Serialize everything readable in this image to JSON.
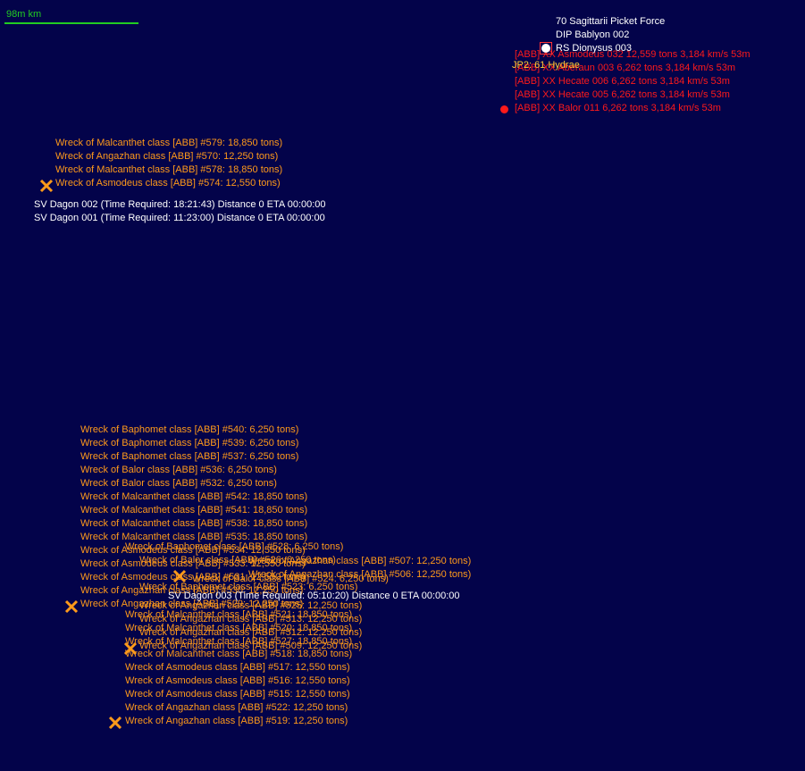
{
  "scale": {
    "label": "98m km"
  },
  "top_right": {
    "white_labels": [
      "70 Sagittarii Picket Force",
      "DIP Bablyon 002",
      "RS Dionysus 003"
    ],
    "jump_point": "JP2: 61 Hydrae",
    "red_labels": [
      "[ABB]  XX Asmodeus 032  12,559 tons   3,184 km/s  53m",
      "[ABB]  XX Aberaun 003  6,262 tons   3,184 km/s  53m",
      "[ABB]  XX Hecate 006  6,262 tons   3,184 km/s  53m",
      "[ABB]  XX Hecate 005  6,262 tons   3,184 km/s  53m",
      "[ABB]  XX Balor 011  6,262 tons   3,184 km/s  53m"
    ]
  },
  "group1": {
    "wrecks": [
      "Wreck of Malcanthet class [ABB] #579: 18,850 tons)",
      "Wreck of Angazhan class [ABB] #570: 12,250 tons)",
      "Wreck of Malcanthet class [ABB] #578: 18,850 tons)",
      "Wreck of Asmodeus class [ABB] #574: 12,550 tons)"
    ],
    "ships": [
      "SV Dagon 002  (Time Required: 18:21:43)      Distance 0    ETA 00:00:00",
      "SV Dagon 001  (Time Required: 11:23:00)      Distance 0    ETA 00:00:00"
    ]
  },
  "group2": {
    "wrecks": [
      "Wreck of Baphomet class [ABB] #540: 6,250 tons)",
      "Wreck of Baphomet class [ABB] #539: 6,250 tons)",
      "Wreck of Baphomet class [ABB] #537: 6,250 tons)",
      "Wreck of Balor class [ABB] #536: 6,250 tons)",
      "Wreck of Balor class [ABB] #532: 6,250 tons)",
      "Wreck of Malcanthet class [ABB] #542: 18,850 tons)",
      "Wreck of Malcanthet class [ABB] #541: 18,850 tons)",
      "Wreck of Malcanthet class [ABB] #538: 18,850 tons)",
      "Wreck of Malcanthet class [ABB] #535: 18,850 tons)",
      "Wreck of Asmodeus class [ABB] #534: 12,550 tons)",
      "Wreck of Asmodeus class [ABB] #533: 12,550 tons)",
      "Wreck of Asmodeus class [ABB] #531: 12,550 tons)",
      "Wreck of Angazhan class [ABB] #530: 12,250 tons)",
      "Wreck of Angazhan class [ABB] #529: 12,250 tons)"
    ]
  },
  "group3": {
    "overlap_wrecks": [
      "Wreck of Baphomet class [ABB] #528: 6,250 tons)",
      "Wreck of Balor class [ABB] #526: 6,250 tons)",
      "Wreck of Balor class [ABB] #524: 6,250 tons)",
      "Wreck of Baphomet class [ABB] #523: 6,250 tons)",
      "Wreck of Angazhan class [ABB] #507: 12,250 tons)",
      "Wreck of Angazhan class [ABB] #506: 12,250 tons)",
      "Wreck of Angazhan class [ABB] #525: 12,250 tons)",
      "Wreck of Malcanthet class [ABB] #521: 18,850 tons)",
      "Wreck of Angazhan class [ABB] #513: 12,250 tons)",
      "Wreck of Malcanthet class [ABB] #520: 18,850 tons)",
      "Wreck of Angazhan class [ABB] #512: 12,250 tons)",
      "Wreck of Malcanthet class [ABB] #527: 18,850 tons)",
      "Wreck of Angazhan class [ABB] #509: 12,250 tons)"
    ],
    "ship": "SV Dagon 003  (Time Required: 05:10:20)      Distance 0    ETA 00:00:00",
    "wrecks": [
      "Wreck of Malcanthet class [ABB] #518: 18,850 tons)",
      "Wreck of Asmodeus class [ABB] #517: 12,550 tons)",
      "Wreck of Asmodeus class [ABB] #516: 12,550 tons)",
      "Wreck of Asmodeus class [ABB] #515: 12,550 tons)",
      "Wreck of Angazhan class [ABB] #522: 12,250 tons)",
      "Wreck of Angazhan class [ABB] #519: 12,250 tons)"
    ]
  },
  "colors": {
    "background": "#03034a",
    "wreck": "#ff9a1a",
    "hostile": "#ff1a1a",
    "scale": "#22cc22",
    "friendly": "#ffffff"
  }
}
